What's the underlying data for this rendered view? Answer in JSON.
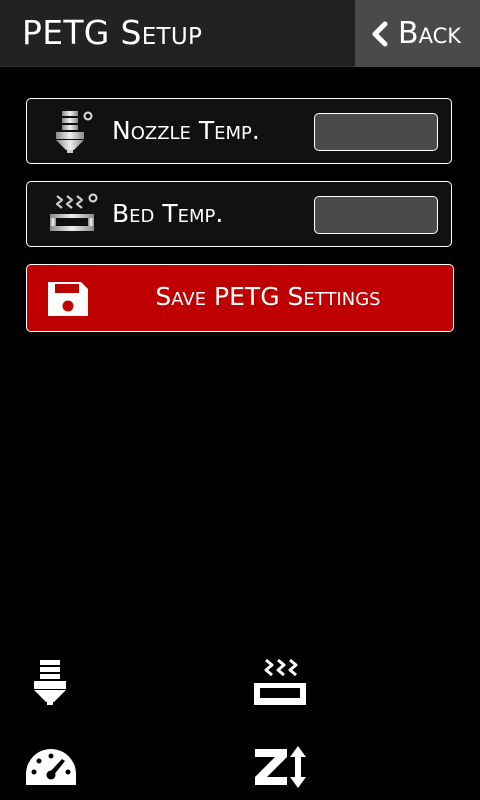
{
  "header": {
    "title": "PETG Setup",
    "back_label": "Back"
  },
  "settings": {
    "nozzle": {
      "label": "Nozzle Temp.",
      "value": "",
      "icon": "nozzle-icon"
    },
    "bed": {
      "label": "Bed Temp.",
      "value": "",
      "icon": "heated-bed-icon"
    }
  },
  "save_button": {
    "label": "Save PETG Settings",
    "icon": "floppy-disk-icon"
  },
  "bottom_nav": [
    {
      "icon": "extruder-icon"
    },
    {
      "icon": "heated-bed-icon"
    },
    {
      "icon": "speedometer-icon"
    },
    {
      "icon": "z-axis-icon"
    }
  ],
  "colors": {
    "background": "#000000",
    "header": "#222222",
    "back_button": "#4a4a4a",
    "input": "#4a4a4a",
    "save_button": "#bf0000",
    "text": "#ffffff"
  }
}
